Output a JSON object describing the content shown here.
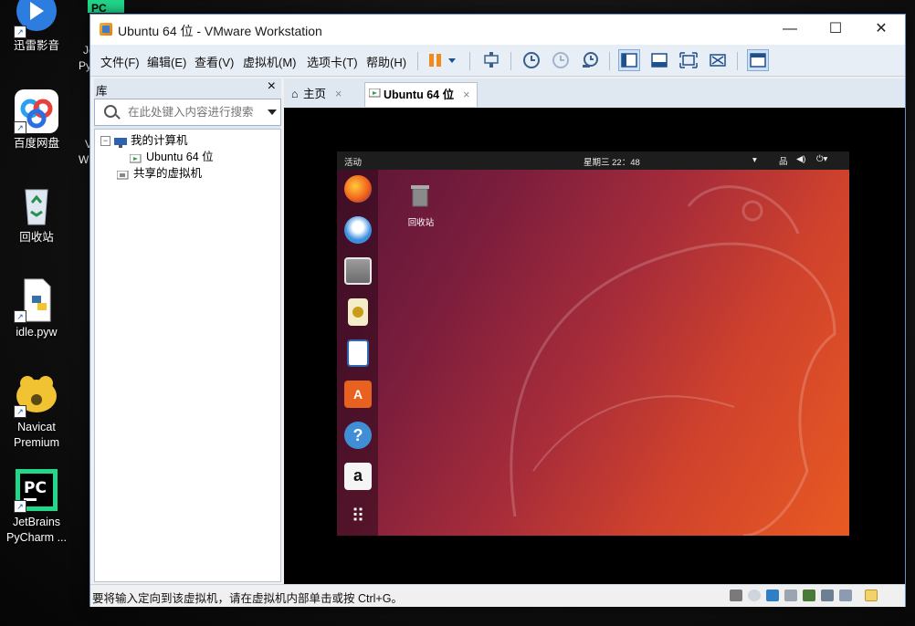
{
  "desktop": {
    "icons": [
      {
        "label": "迅雷影音"
      },
      {
        "label": "百度网盘"
      },
      {
        "label": "回收站"
      },
      {
        "label": "idle.pyw"
      },
      {
        "label": "Navicat\nPremium"
      },
      {
        "label": "JetBrains\nPyCharm ..."
      }
    ],
    "partial_labels": [
      "Je",
      "Py",
      "V",
      "W"
    ]
  },
  "window": {
    "title": "Ubuntu 64 位 - VMware Workstation",
    "min": "—",
    "max": "☐",
    "close": "✕"
  },
  "menu": {
    "items": [
      "文件(F)",
      "编辑(E)",
      "查看(V)",
      "虚拟机(M)",
      "选项卡(T)",
      "帮助(H)"
    ]
  },
  "library": {
    "title": "库",
    "close": "×",
    "search_placeholder": "在此处键入内容进行搜索",
    "tree": {
      "my_computer": "我的计算机",
      "vm": "Ubuntu 64 位",
      "shared": "共享的虚拟机"
    }
  },
  "tabs": [
    {
      "label": "主页",
      "close": "×"
    },
    {
      "label": "Ubuntu 64 位",
      "close": "×"
    }
  ],
  "ubuntu": {
    "activities": "活动",
    "clock": "星期三 22：48",
    "trash_label": "回收站"
  },
  "status": {
    "message": "要将输入定向到该虚拟机，请在虚拟机内部单击或按 Ctrl+G。"
  },
  "colors": {
    "title_accent": "#3c7ec7",
    "ubuntu_orange": "#e85a22",
    "ubuntu_aubergine": "#5a1536"
  }
}
